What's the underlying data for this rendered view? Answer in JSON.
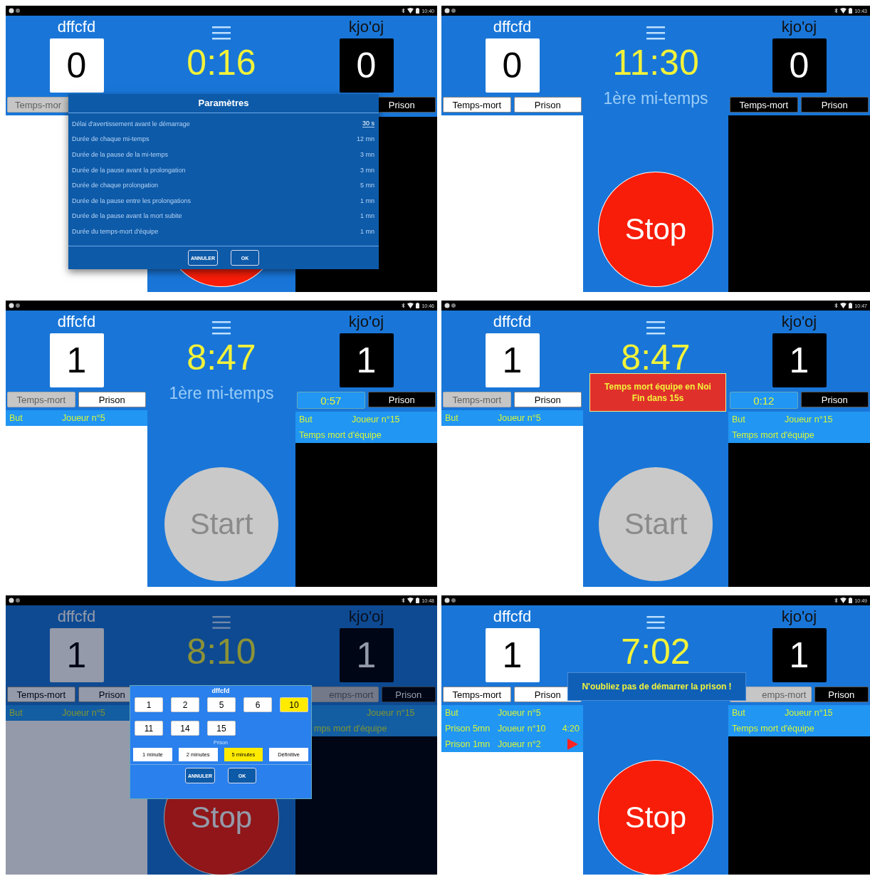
{
  "screens": [
    {
      "status_time": "10:40",
      "left": {
        "kind": "light",
        "name": "dffcfd",
        "score": "0",
        "timeout": {
          "label": "Temps-mor",
          "disabled": true
        }
      },
      "right": {
        "kind": "dark",
        "name": "kjo'oj",
        "score": "0",
        "prison": {
          "label": "Prison",
          "disabled": false
        }
      },
      "clock": "0:16",
      "main": {
        "kind": "stop"
      },
      "overlay": {
        "kind": "settings",
        "title": "Paramètres",
        "rows": [
          {
            "kind": "input",
            "label": "Délai d'avertissement avant le démarrage",
            "value": "30 s"
          },
          {
            "kind": "text",
            "label": "Durée de chaque mi-temps",
            "value": "12 mn"
          },
          {
            "kind": "text",
            "label": "Durée de la pause de la mi-temps",
            "value": "3 mn"
          },
          {
            "kind": "text",
            "label": "Durée de la pause avant la prolongation",
            "value": "3 mn"
          },
          {
            "kind": "text",
            "label": "Durée de chaque prolongation",
            "value": "5 mn"
          },
          {
            "kind": "text",
            "label": "Durée de la pause entre les prolongations",
            "value": "1 mn"
          },
          {
            "kind": "text",
            "label": "Durée de la pause avant la mort subite",
            "value": "1 mn"
          },
          {
            "kind": "text",
            "label": "Durée du temps-mort d'équipe",
            "value": "1 mn"
          }
        ],
        "buttons": [
          "ANNULER",
          "OK"
        ]
      }
    },
    {
      "status_time": "10:43",
      "left": {
        "kind": "light",
        "name": "dffcfd",
        "score": "0",
        "timeout": {
          "label": "Temps-mort",
          "disabled": false
        },
        "prison": {
          "label": "Prison",
          "disabled": false
        }
      },
      "right": {
        "kind": "dark",
        "name": "kjo'oj",
        "score": "0",
        "timeout": {
          "label": "Temps-mort",
          "disabled": false
        },
        "prison": {
          "label": "Prison",
          "disabled": false
        }
      },
      "clock": "11:30",
      "period": "1ère mi-temps",
      "main": {
        "kind": "stop",
        "label": "Stop"
      }
    },
    {
      "status_time": "10:46",
      "left": {
        "kind": "light",
        "name": "dffcfd",
        "score": "1",
        "timeout": {
          "label": "Temps-mort",
          "disabled": true
        },
        "prison": {
          "label": "Prison",
          "disabled": false
        },
        "events": [
          {
            "label": "But",
            "player": "Joueur n°5",
            "play_button": false
          }
        ]
      },
      "right": {
        "kind": "dark",
        "name": "kjo'oj",
        "score": "1",
        "timeout_timer": "0:57",
        "prison": {
          "label": "Prison",
          "disabled": false
        },
        "events": [
          {
            "label": "But",
            "player": "Joueur n°15",
            "play_button": false
          },
          {
            "label": "Temps mort d'équipe",
            "play_button": false
          }
        ]
      },
      "clock": "8:47",
      "period": "1ère mi-temps",
      "main": {
        "kind": "start",
        "label": "Start"
      }
    },
    {
      "status_time": "10:47",
      "left": {
        "kind": "light",
        "name": "dffcfd",
        "score": "1",
        "timeout": {
          "label": "Temps-mort",
          "disabled": true
        },
        "prison": {
          "label": "Prison",
          "disabled": false
        },
        "events": [
          {
            "label": "But",
            "player": "Joueur n°5",
            "play_button": false
          }
        ]
      },
      "right": {
        "kind": "dark",
        "name": "kjo'oj",
        "score": "1",
        "timeout_timer": "0:12",
        "prison": {
          "label": "Prison",
          "disabled": false
        },
        "events": [
          {
            "label": "But",
            "player": "Joueur n°15",
            "play_button": false
          },
          {
            "label": "Temps mort d'équipe",
            "play_button": false
          }
        ]
      },
      "clock": "8:47",
      "main": {
        "kind": "start",
        "label": "Start"
      },
      "overlay": {
        "kind": "alert",
        "lines": [
          "Temps mort équipe en Noi",
          "Fin dans 15s"
        ]
      }
    },
    {
      "status_time": "10:48",
      "left": {
        "kind": "light",
        "name": "dffcfd",
        "score": "1",
        "timeout": {
          "label": "Temps-mort",
          "disabled": false
        },
        "prison": {
          "label": "Prison",
          "disabled": false
        },
        "events": [
          {
            "label": "But",
            "player": "Joueur n°5",
            "play_button": false
          }
        ]
      },
      "right": {
        "kind": "dark",
        "name": "kjo'oj",
        "score": "1",
        "timeout": {
          "label": "emps-mort",
          "disabled": true
        },
        "prison": {
          "label": "Prison",
          "disabled": false
        },
        "events": [
          {
            "player": "Joueur n°15",
            "play_button": false
          },
          {
            "label": "mps mort d'équipe",
            "play_button": false
          }
        ]
      },
      "clock": "8:10",
      "main": {
        "kind": "stop",
        "label": "Stop"
      },
      "overlay": {
        "kind": "player_picker",
        "dim": true,
        "title": "dffcfd",
        "players": [
          {
            "label": "1",
            "selected": false
          },
          {
            "label": "2",
            "selected": false
          },
          {
            "label": "5",
            "selected": false
          },
          {
            "label": "6",
            "selected": false
          },
          {
            "label": "10",
            "selected": true
          },
          {
            "label": "11",
            "selected": false
          },
          {
            "label": "14",
            "selected": false
          },
          {
            "label": "15",
            "selected": false
          }
        ],
        "section": "Prison",
        "durations": [
          {
            "label": "1 minute",
            "selected": false
          },
          {
            "label": "2 minutes",
            "selected": false
          },
          {
            "label": "5 minutes",
            "selected": true
          },
          {
            "label": "Définitive",
            "selected": false
          }
        ],
        "buttons": [
          "ANNULER",
          "OK"
        ]
      }
    },
    {
      "status_time": "10:49",
      "left": {
        "kind": "light",
        "name": "dffcfd",
        "score": "1",
        "timeout": {
          "label": "Temps-mort",
          "disabled": false
        },
        "prison": {
          "label": "Prison",
          "disabled": false
        },
        "events": [
          {
            "label": "But",
            "player": "Joueur n°5",
            "play_button": false
          },
          {
            "label": "Prison 5mn",
            "player": "Joueur n°10",
            "time": "4:20",
            "play_button": false
          },
          {
            "label": "Prison 1mn",
            "player": "Joueur n°2",
            "play_button": true
          }
        ]
      },
      "right": {
        "kind": "dark",
        "name": "kjo'oj",
        "score": "1",
        "timeout": {
          "label": "emps-mort",
          "disabled": true
        },
        "prison": {
          "label": "Prison",
          "disabled": false
        },
        "events": [
          {
            "label": "But",
            "player": "Joueur n°15",
            "play_button": false
          },
          {
            "label": "Temps mort d'équipe",
            "play_button": false
          }
        ]
      },
      "clock": "7:02",
      "main": {
        "kind": "stop",
        "label": "Stop"
      },
      "overlay": {
        "kind": "info",
        "lines": [
          "N'oubliez pas de démarrer la prison !"
        ]
      }
    }
  ]
}
